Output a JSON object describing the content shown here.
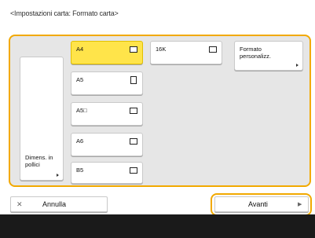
{
  "title": "<Impostazioni carta: Formato carta>",
  "sizes": {
    "a4": "A4",
    "a5": "A5",
    "a5r": "A5□",
    "a6": "A6",
    "b5": "B5",
    "k16": "16K"
  },
  "inch_button": {
    "label": "Dimens. in pollici"
  },
  "custom_button": {
    "label": "Formato personalizz."
  },
  "footer": {
    "cancel_icon": "✕",
    "cancel_label": "Annulla",
    "next_label": "Avanti",
    "next_icon": "▶"
  },
  "colors": {
    "accent": "#f2a900",
    "selected": "#ffe44a",
    "panel_bg": "#e6e6e6"
  }
}
